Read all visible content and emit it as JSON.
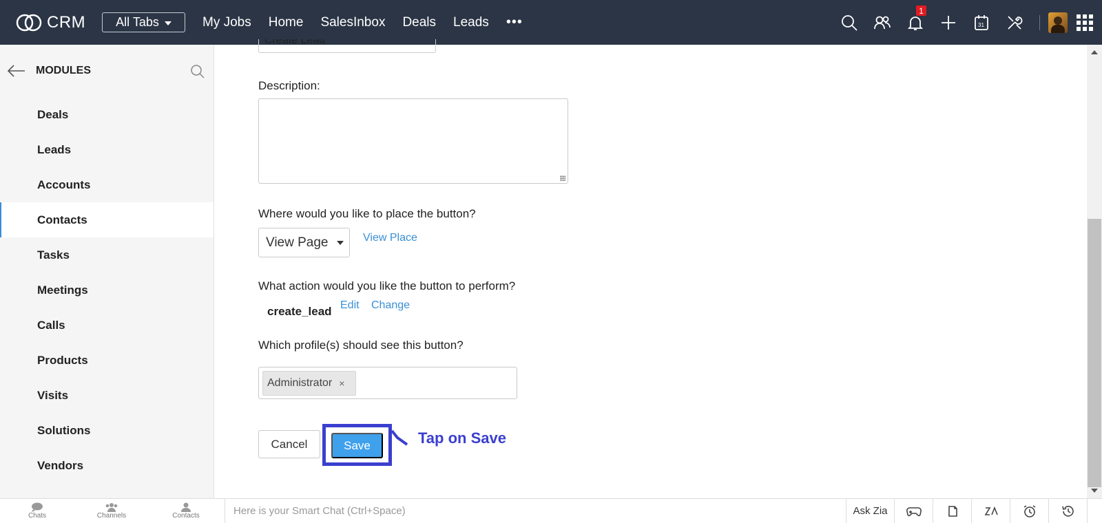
{
  "header": {
    "brand": "CRM",
    "all_tabs": "All Tabs",
    "nav": [
      "My Jobs",
      "Home",
      "SalesInbox",
      "Deals",
      "Leads"
    ],
    "more": "•••",
    "notification_count": "1"
  },
  "sidebar": {
    "title": "MODULES",
    "items": [
      "Deals",
      "Leads",
      "Accounts",
      "Contacts",
      "Tasks",
      "Meetings",
      "Calls",
      "Products",
      "Visits",
      "Solutions",
      "Vendors"
    ],
    "active": "Contacts"
  },
  "form": {
    "name_value": "Create Lead",
    "description_label": "Description:",
    "description_value": "",
    "placement_label": "Where would you like to place the button?",
    "placement_value": "View Page",
    "view_place_link": "View Place",
    "action_label": "What action would you like the button to perform?",
    "action_name": "create_lead",
    "edit_link": "Edit",
    "change_link": "Change",
    "profiles_label": "Which profile(s) should see this button?",
    "profile_chip": "Administrator",
    "chip_remove": "×",
    "cancel_label": "Cancel",
    "save_label": "Save",
    "hint": "Tap on Save"
  },
  "bottombar": {
    "tabs": [
      "Chats",
      "Channels",
      "Contacts"
    ],
    "chat_placeholder": "Here is your Smart Chat (Ctrl+Space)",
    "ask_zia": "Ask Zia"
  }
}
